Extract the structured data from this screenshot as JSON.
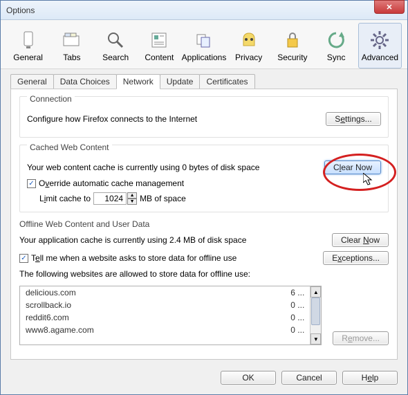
{
  "window_title": "Options",
  "toolbar": [
    {
      "label": "General"
    },
    {
      "label": "Tabs"
    },
    {
      "label": "Search"
    },
    {
      "label": "Content"
    },
    {
      "label": "Applications"
    },
    {
      "label": "Privacy"
    },
    {
      "label": "Security"
    },
    {
      "label": "Sync"
    },
    {
      "label": "Advanced"
    }
  ],
  "subtabs": [
    "General",
    "Data Choices",
    "Network",
    "Update",
    "Certificates"
  ],
  "connection": {
    "title": "Connection",
    "desc": "Configure how Firefox connects to the Internet",
    "settings_btn": "Settings..."
  },
  "cached": {
    "title": "Cached Web Content",
    "status": "Your web content cache is currently using 0 bytes of disk space",
    "clear_btn": "Clear Now",
    "override_pre": "O",
    "override_mid": "v",
    "override_post": "erride automatic cache management",
    "limit_pre": "L",
    "limit_mid": "i",
    "limit_post": "mit cache to",
    "limit_value": "1024",
    "limit_suffix": "MB of space"
  },
  "offline": {
    "title": "Offline Web Content and User Data",
    "status": "Your application cache is currently using 2.4 MB of disk space",
    "clear_btn": "Clear Now",
    "tell_pre": "T",
    "tell_mid": "e",
    "tell_post": "ll me when a website asks to store data for offline use",
    "exceptions_btn": "Exceptions...",
    "sites_desc": "The following websites are allowed to store data for offline use:",
    "sites": [
      {
        "host": "delicious.com",
        "size": "6 ..."
      },
      {
        "host": "scrollback.io",
        "size": "0 ..."
      },
      {
        "host": "reddit6.com",
        "size": "0 ..."
      },
      {
        "host": "www8.agame.com",
        "size": "0 ..."
      }
    ],
    "remove_pre": "R",
    "remove_mid": "e",
    "remove_post": "move..."
  },
  "buttons": {
    "ok": "OK",
    "cancel": "Cancel",
    "help_pre": "H",
    "help_mid": "e",
    "help_post": "lp"
  }
}
